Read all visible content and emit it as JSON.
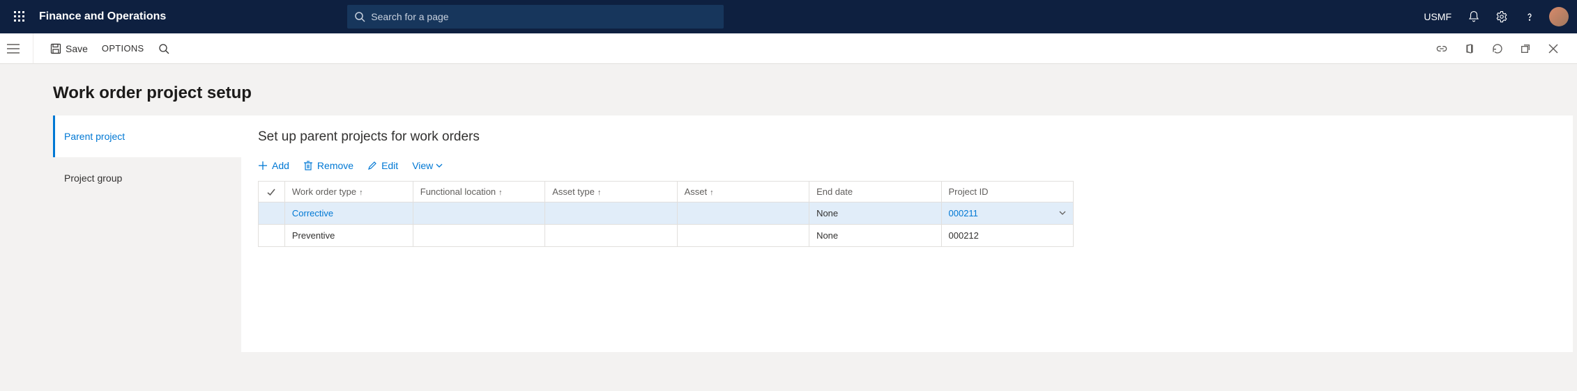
{
  "navbar": {
    "brand": "Finance and Operations",
    "search_placeholder": "Search for a page",
    "company": "USMF"
  },
  "commandbar": {
    "save_label": "Save",
    "options_label": "OPTIONS"
  },
  "page": {
    "title": "Work order project setup"
  },
  "sidenav": {
    "items": [
      {
        "label": "Parent project",
        "active": true
      },
      {
        "label": "Project group",
        "active": false
      }
    ]
  },
  "panel": {
    "heading": "Set up parent projects for work orders",
    "actions": {
      "add": "Add",
      "remove": "Remove",
      "edit": "Edit",
      "view": "View"
    },
    "columns": {
      "work_order_type": "Work order type",
      "functional_location": "Functional location",
      "asset_type": "Asset type",
      "asset": "Asset",
      "end_date": "End date",
      "project_id": "Project ID"
    },
    "rows": [
      {
        "work_order_type": "Corrective",
        "functional_location": "",
        "asset_type": "",
        "asset": "",
        "end_date": "None",
        "project_id": "000211",
        "selected": true
      },
      {
        "work_order_type": "Preventive",
        "functional_location": "",
        "asset_type": "",
        "asset": "",
        "end_date": "None",
        "project_id": "000212",
        "selected": false
      }
    ]
  }
}
